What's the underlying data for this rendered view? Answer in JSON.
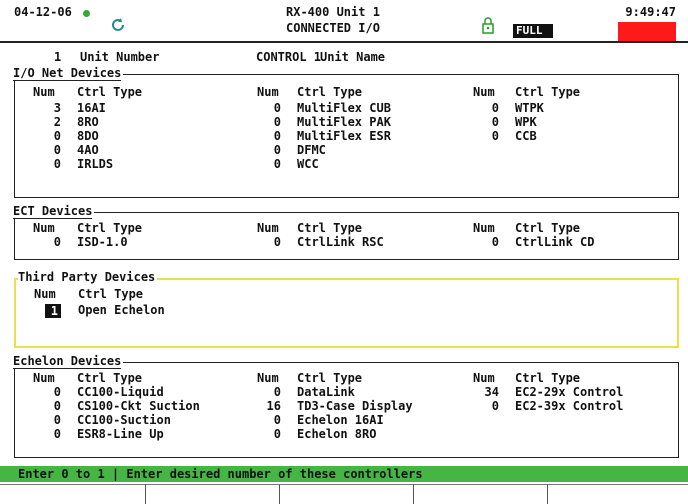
{
  "header": {
    "date": "04-12-06",
    "title": "RX-400 Unit 1",
    "subtitle": "CONNECTED I/O",
    "time": "9:49:47",
    "full_badge": "FULL"
  },
  "unit": {
    "number": "1",
    "number_label": "Unit Number",
    "name": "CONTROL 1",
    "name_label": "Unit Name"
  },
  "columns": {
    "num": "Num",
    "type": "Ctrl Type"
  },
  "sections": {
    "io_net": {
      "title": "I/O Net Devices",
      "col1": [
        {
          "num": "3",
          "type": "16AI"
        },
        {
          "num": "2",
          "type": "8RO"
        },
        {
          "num": "0",
          "type": "8DO"
        },
        {
          "num": "0",
          "type": "4AO"
        },
        {
          "num": "0",
          "type": "IRLDS"
        }
      ],
      "col2": [
        {
          "num": "0",
          "type": "MultiFlex CUB"
        },
        {
          "num": "0",
          "type": "MultiFlex PAK"
        },
        {
          "num": "0",
          "type": "MultiFlex ESR"
        },
        {
          "num": "0",
          "type": "DFMC"
        },
        {
          "num": "0",
          "type": "WCC"
        }
      ],
      "col3": [
        {
          "num": "0",
          "type": "WTPK"
        },
        {
          "num": "0",
          "type": "WPK"
        },
        {
          "num": "0",
          "type": "CCB"
        }
      ]
    },
    "ect": {
      "title": "ECT Devices",
      "col1": [
        {
          "num": "0",
          "type": "ISD-1.0"
        }
      ],
      "col2": [
        {
          "num": "0",
          "type": "CtrlLink RSC"
        }
      ],
      "col3": [
        {
          "num": "0",
          "type": "CtrlLink CD"
        }
      ]
    },
    "third_party": {
      "title": "Third Party Devices",
      "col1": [
        {
          "num": "1",
          "type": "Open Echelon"
        }
      ]
    },
    "echelon": {
      "title": "Echelon Devices",
      "col1": [
        {
          "num": "0",
          "type": "CC100-Liquid"
        },
        {
          "num": "0",
          "type": "CS100-Ckt Suction"
        },
        {
          "num": "0",
          "type": "CC100-Suction"
        },
        {
          "num": "0",
          "type": "ESR8-Line Up"
        }
      ],
      "col2": [
        {
          "num": "0",
          "type": "DataLink"
        },
        {
          "num": "16",
          "type": "TD3-Case Display"
        },
        {
          "num": "0",
          "type": "Echelon 16AI"
        },
        {
          "num": "0",
          "type": "Echelon 8RO"
        }
      ],
      "col3": [
        {
          "num": "34",
          "type": "EC2-29x Control"
        },
        {
          "num": "0",
          "type": "EC2-39x Control"
        }
      ]
    }
  },
  "prompt": "Enter 0 to 1 | Enter desired number of these controllers",
  "colors": {
    "prompt_bar": "#46b546",
    "alarm": "#ff1a1a",
    "highlight_border": "#e7e24a"
  }
}
